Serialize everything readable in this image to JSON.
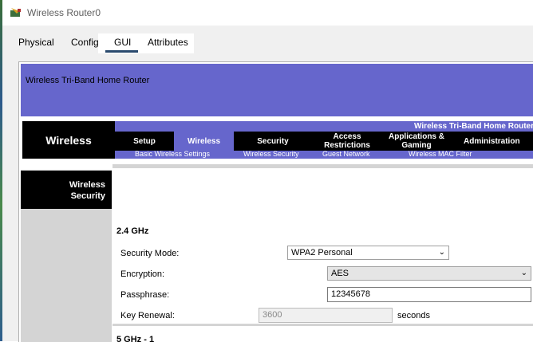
{
  "window": {
    "title": "Wireless Router0"
  },
  "tabs": [
    {
      "label": "Physical"
    },
    {
      "label": "Config"
    },
    {
      "label": "GUI"
    },
    {
      "label": "Attributes"
    }
  ],
  "banner": {
    "text": "Wireless Tri-Band Home Router"
  },
  "nav": {
    "brand": "Wireless",
    "top_text": "Wireless Tri-Band Home Router",
    "items": [
      {
        "label": "Setup"
      },
      {
        "label": "Wireless"
      },
      {
        "label": "Security"
      },
      {
        "label": "Access Restrictions"
      },
      {
        "label": "Applications & Gaming"
      },
      {
        "label": "Administration"
      }
    ],
    "sub_items": [
      {
        "label": "Basic Wireless Settings"
      },
      {
        "label": "Wireless Security"
      },
      {
        "label": "Guest Network"
      },
      {
        "label": "Wireless MAC Filter"
      }
    ]
  },
  "side": {
    "heading_line1": "Wireless",
    "heading_line2": "Security"
  },
  "band_24": {
    "title": "2.4 GHz",
    "security_mode_label": "Security Mode:",
    "security_mode_value": "WPA2 Personal",
    "encryption_label": "Encryption:",
    "encryption_value": "AES",
    "passphrase_label": "Passphrase:",
    "passphrase_value": "12345678",
    "key_renewal_label": "Key Renewal:",
    "key_renewal_value": "3600",
    "key_renewal_unit": "seconds"
  },
  "band_5": {
    "title": "5 GHz - 1"
  },
  "colors": {
    "accent": "#6666cc",
    "nav_bg": "#000000",
    "side_bg": "#d4d4d4"
  }
}
